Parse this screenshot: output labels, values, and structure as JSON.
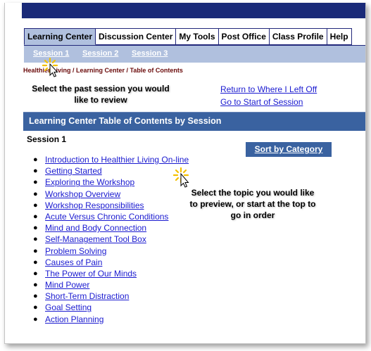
{
  "tabs": [
    {
      "label": "Learning Center",
      "active": true
    },
    {
      "label": "Discussion Center",
      "active": false
    },
    {
      "label": "My Tools",
      "active": false
    },
    {
      "label": "Post Office",
      "active": false
    },
    {
      "label": "Class Profile",
      "active": false
    },
    {
      "label": "Help",
      "active": false
    }
  ],
  "sessions": [
    "Session 1",
    "Session 2",
    "Session 3"
  ],
  "breadcrumb": "Healthier Living / Learning Center / Table of Contents",
  "callouts": {
    "session": "Select the past session you would like to review",
    "topic": "Select the topic you would like to preview, or start at the top to go in order"
  },
  "links": {
    "return": "Return to Where I Left Off",
    "start": "Go to Start of Session"
  },
  "toc_title": "Learning Center Table of Contents by Session",
  "session_title": "Session 1",
  "sort_button": "Sort by Category",
  "topics": [
    "Introduction to Healthier Living On-line",
    "Getting Started",
    "Exploring the Workshop",
    "Workshop Overview",
    "Workshop Responsibilities",
    "Acute Versus Chronic Conditions",
    "Mind and Body Connection",
    "Self-Management Tool Box",
    "Problem Solving",
    "Causes of Pain",
    "The Power of Our Minds",
    "Mind Power",
    "Short-Term Distraction",
    "Goal Setting",
    "Action Planning"
  ],
  "colors": {
    "topbar": "#1a2a78",
    "subnav": "#b0c0de",
    "header_bar": "#3a62a0",
    "link": "#1a1ad0",
    "breadcrumb": "#6a0a0a"
  },
  "icons": [
    "cursor-click-icon"
  ]
}
